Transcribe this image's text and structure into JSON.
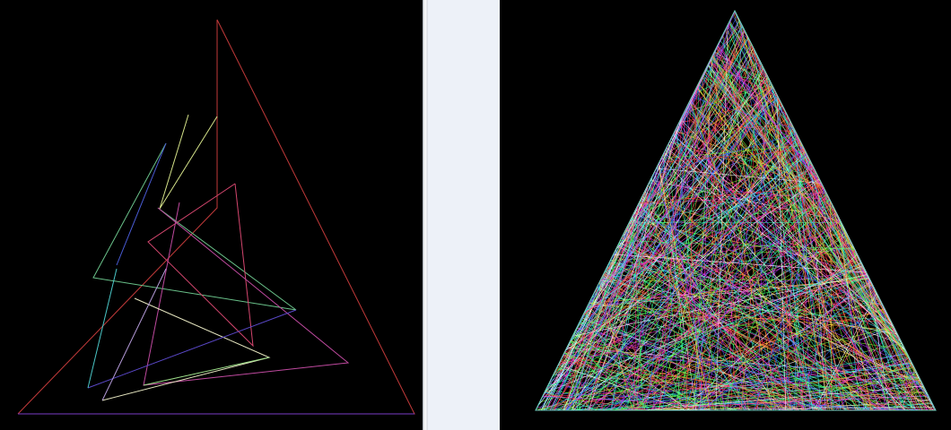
{
  "window": {
    "left_canvas": {
      "description_icon": "triangle-drawing",
      "background_color": "#000000"
    },
    "right_canvas": {
      "description_icon": "dense-triangle-drawing",
      "background_color": "#000000"
    },
    "separator_panel": {
      "background_color": "#edf1f8"
    }
  },
  "colors": {
    "palette": [
      "#ff3b3b",
      "#3bff6a",
      "#3b6bff",
      "#ffd23b",
      "#ff3bd6",
      "#3bf0ff",
      "#b03bff",
      "#ffffff",
      "#ff8a3b",
      "#7dff3b",
      "#3bffb0",
      "#ff3b8a"
    ]
  }
}
